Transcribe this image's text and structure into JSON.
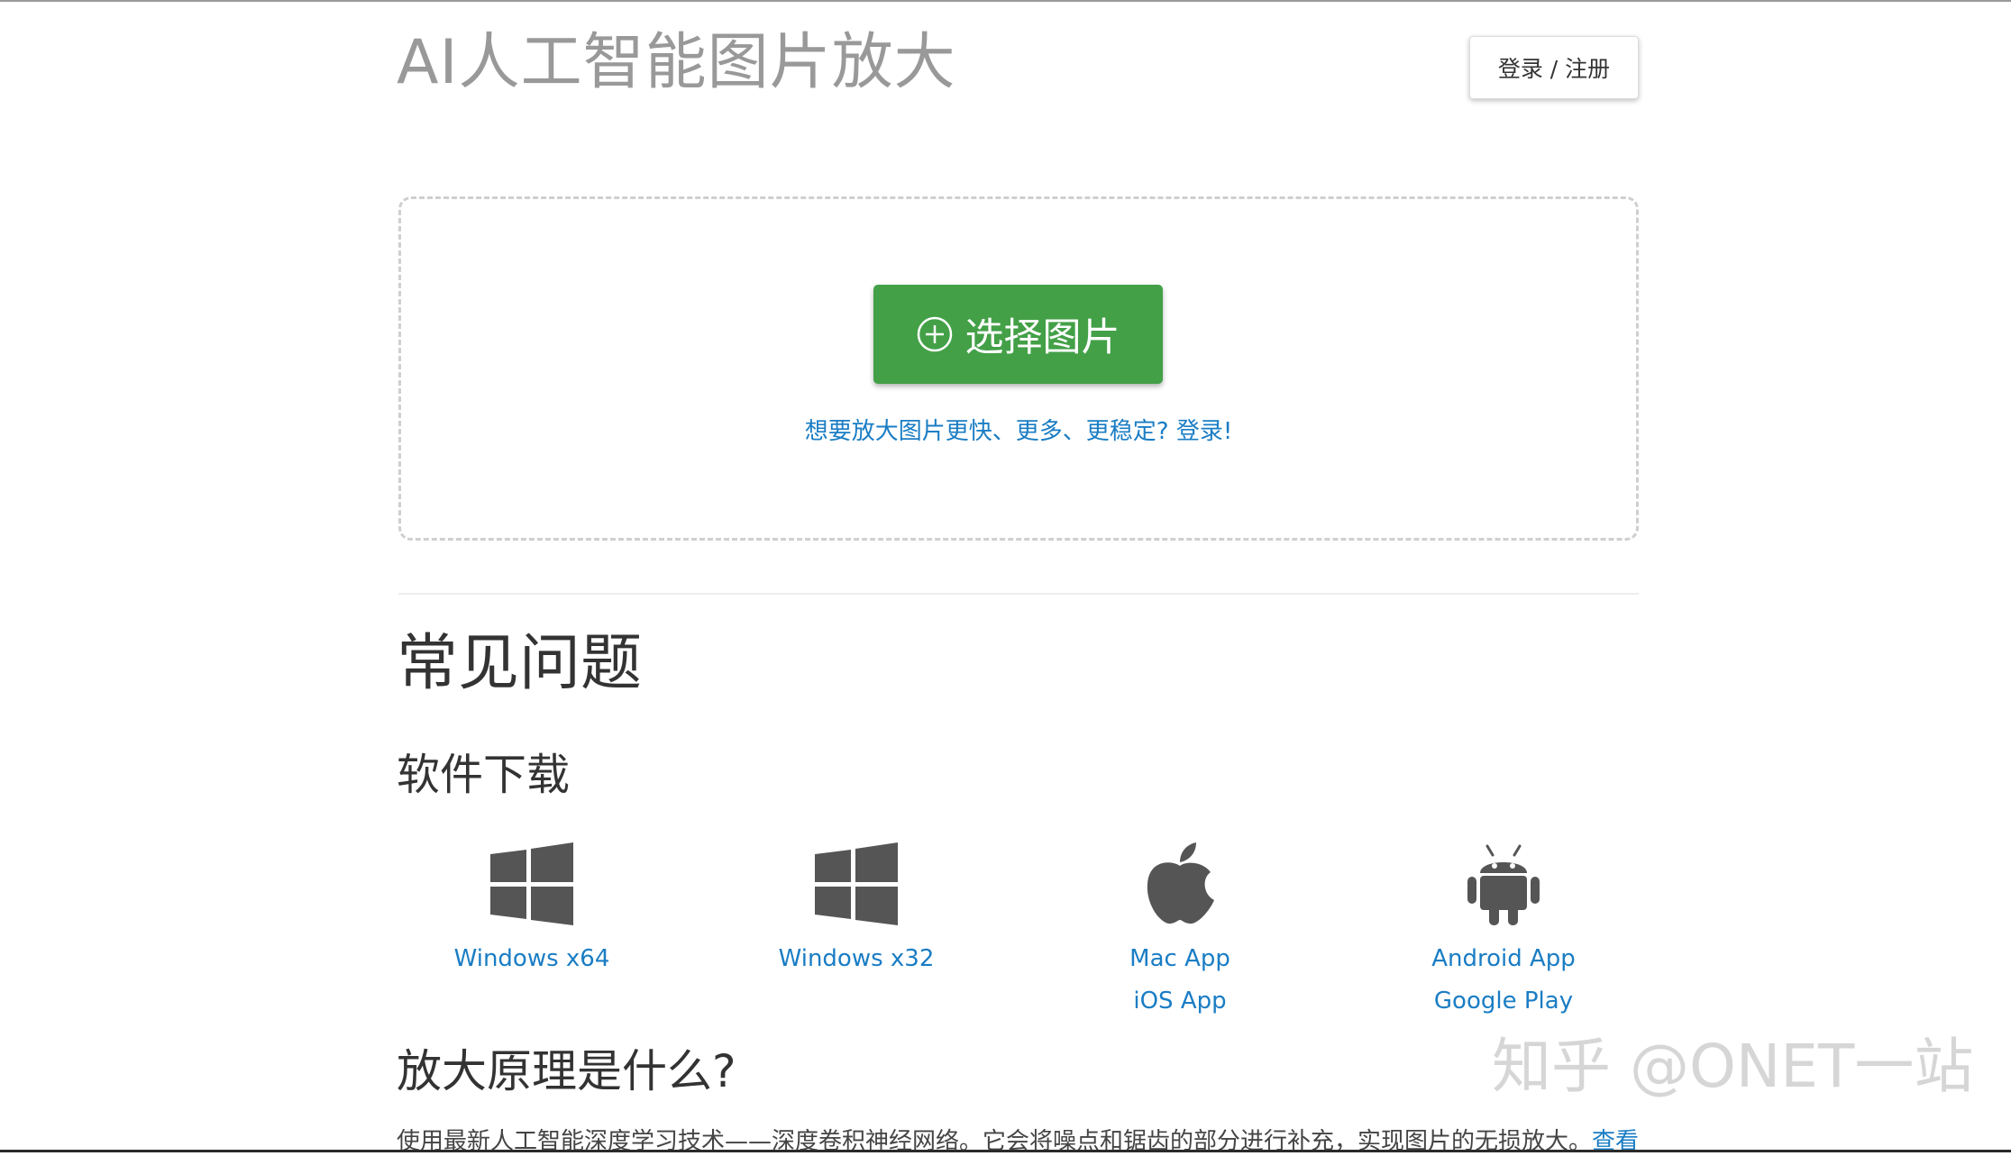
{
  "header": {
    "site_title": "AI人工智能图片放大",
    "login_label": "登录 / 注册"
  },
  "upload": {
    "button_label": "选择图片",
    "promo_text": "想要放大图片更快、更多、更稳定? 登录!"
  },
  "faq": {
    "title": "常见问题",
    "downloads_title": "软件下载",
    "downloads": [
      {
        "icon": "windows-icon",
        "links": [
          "Windows x64"
        ]
      },
      {
        "icon": "windows-icon",
        "links": [
          "Windows x32"
        ]
      },
      {
        "icon": "apple-icon",
        "links": [
          "Mac App",
          "iOS App"
        ]
      },
      {
        "icon": "android-icon",
        "links": [
          "Android App",
          "Google Play"
        ]
      }
    ],
    "principle_title": "放大原理是什么?",
    "principle_text": "使用最新人工智能深度学习技术——深度卷积神经网络。它会将噪点和锯齿的部分进行补充，实现图片的无损放大。",
    "principle_link": "查看"
  },
  "watermark": "知乎 @ONET一站",
  "colors": {
    "accent_green": "#43a047",
    "link_blue": "#1a7dc4",
    "title_gray": "#999999"
  }
}
